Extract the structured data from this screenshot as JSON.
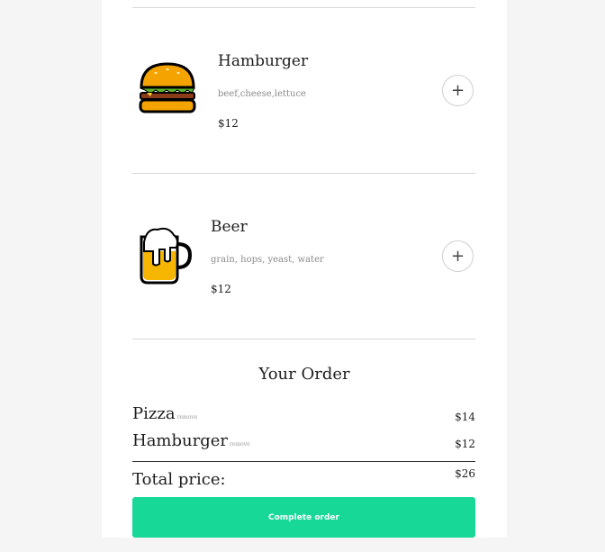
{
  "menu": {
    "items": [
      {
        "name": "Hamburger",
        "ingredients": "beef,cheese,lettuce",
        "price": "$12",
        "icon": "hamburger-icon",
        "add_icon": "plus-icon"
      },
      {
        "name": "Beer",
        "ingredients": "grain, hops, yeast, water",
        "price": "$12",
        "icon": "beer-icon",
        "add_icon": "plus-icon"
      }
    ]
  },
  "order": {
    "title": "Your Order",
    "lines": [
      {
        "name": "Pizza",
        "remove_label": "remove",
        "price": "$14"
      },
      {
        "name": "Hamburger",
        "remove_label": "remove",
        "price": "$12"
      }
    ],
    "total_label": "Total price:",
    "total_value": "$26",
    "complete_label": "Complete order"
  },
  "colors": {
    "accent": "#17d897",
    "background": "#f5f5f5"
  }
}
